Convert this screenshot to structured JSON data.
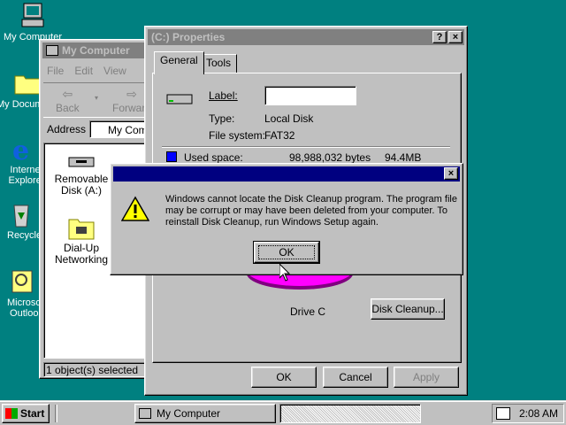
{
  "desktop": {
    "icons": [
      {
        "label": "My Computer"
      },
      {
        "label": "My Documents"
      },
      {
        "label": "Internet Explorer"
      },
      {
        "label": "Recycle Bin"
      },
      {
        "label": "Microsoft Outlook"
      }
    ]
  },
  "my_computer": {
    "title": "My Computer",
    "menu": [
      "File",
      "Edit",
      "View"
    ],
    "toolbar": {
      "back": "Back",
      "forward": "Forward"
    },
    "address_label": "Address",
    "address_value": "My Comp",
    "items": [
      {
        "label": "Removable Disk (A:)"
      },
      {
        "label": "Dial-Up Networking"
      }
    ],
    "status": "1 object(s) selected"
  },
  "properties": {
    "title": "(C:) Properties",
    "tabs": [
      "General",
      "Tools"
    ],
    "label_caption": "Label:",
    "label_value": "",
    "type_caption": "Type:",
    "type_value": "Local Disk",
    "fs_caption": "File system:",
    "fs_value": "FAT32",
    "used_caption": "Used space:",
    "used_bytes": "98,988,032 bytes",
    "used_mb": "94.4MB",
    "drive_caption": "Drive C",
    "disk_cleanup_button": "Disk Cleanup...",
    "ok_button": "OK",
    "cancel_button": "Cancel",
    "apply_button": "Apply",
    "help_button": "?",
    "close_button": "×",
    "colors": {
      "used": "#0000ff",
      "pie": "#c000c0"
    }
  },
  "error_dialog": {
    "message_line1": "Windows cannot locate the Disk Cleanup program. The program file",
    "message_line2": "may be corrupt or may have been deleted from your computer. To",
    "message_line3": "reinstall Disk Cleanup, run Windows Setup again.",
    "ok_button": "OK",
    "close_button": "×"
  },
  "taskbar": {
    "start_label": "Start",
    "task_button": "My Computer",
    "clock": "2:08 AM"
  }
}
